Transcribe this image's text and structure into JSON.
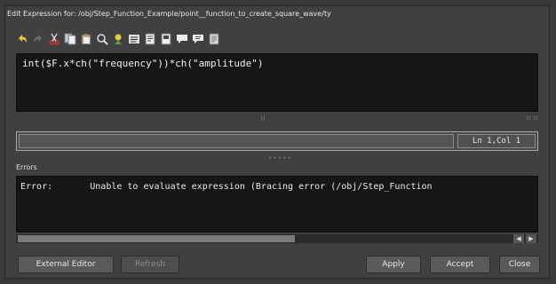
{
  "window": {
    "title": "Edit Expression for: /obj/Step_Function_Example/point__function_to_create_square_wave/ty"
  },
  "toolbar": {
    "icons": [
      "undo-icon",
      "redo-icon",
      "cut-icon",
      "copy-icon",
      "paste-icon",
      "find-icon",
      "replace-icon",
      "select-all-icon",
      "open-file-icon",
      "save-file-icon",
      "comment-icon",
      "uncomment-icon",
      "info-icon"
    ]
  },
  "editor": {
    "expression": "int($F.x*ch(\"frequency\"))*ch(\"amplitude\")"
  },
  "parameter": {
    "value": "",
    "cursor_position": "Ln 1,Col 1"
  },
  "errors": {
    "section_label": "Errors",
    "message": "Error:       Unable to evaluate expression (Bracing error (/obj/Step_Function"
  },
  "buttons": {
    "external_editor": "External Editor",
    "refresh": "Refresh",
    "apply": "Apply",
    "accept": "Accept",
    "close": "Close"
  }
}
